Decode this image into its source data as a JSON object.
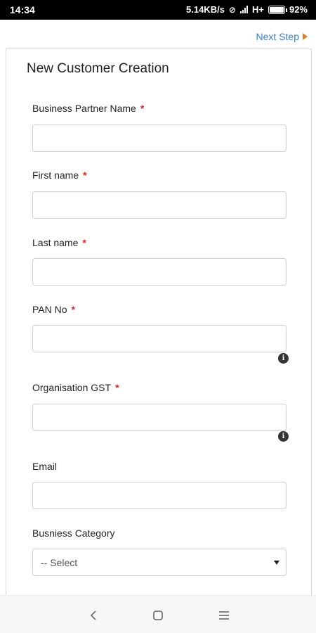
{
  "status_bar": {
    "time": "14:34",
    "network_speed": "5.14KB/s",
    "network_type": "H+",
    "battery": "92%"
  },
  "header": {
    "next_step": "Next Step"
  },
  "form": {
    "title": "New Customer Creation",
    "fields": [
      {
        "label": "Business Partner Name",
        "required": "*",
        "value": ""
      },
      {
        "label": "First name",
        "required": "*",
        "value": ""
      },
      {
        "label": "Last name",
        "required": "*",
        "value": ""
      },
      {
        "label": "PAN No",
        "required": "*",
        "value": ""
      },
      {
        "label": "Organisation GST",
        "required": "*",
        "value": ""
      },
      {
        "label": "Email",
        "value": ""
      }
    ],
    "category": {
      "label": "Busniess Category",
      "selected": "-- Select"
    }
  },
  "colors": {
    "link": "#3f7fcf",
    "arrow": "#e67e22",
    "required": "#d9262e"
  },
  "icons": [
    "alarm-off-icon",
    "signal-icon",
    "battery-icon",
    "next-arrow-icon",
    "info-icon",
    "back-icon",
    "home-icon",
    "menu-icon"
  ]
}
